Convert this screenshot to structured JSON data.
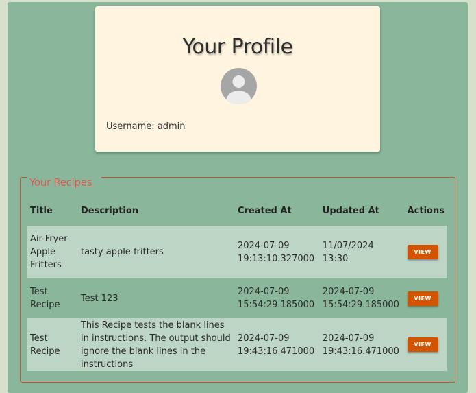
{
  "profile": {
    "title": "Your Profile",
    "username_label": "Username: admin"
  },
  "recipes": {
    "legend": "Your Recipes",
    "columns": {
      "title": "Title",
      "description": "Description",
      "created": "Created At",
      "updated": "Updated At",
      "actions": "Actions"
    },
    "rows": [
      {
        "title": "Air-Fryer Apple Fritters",
        "description": "tasty apple fritters",
        "created": "2024-07-09 19:13:10.327000",
        "updated": "11/07/2024 13:30",
        "action": "VIEW"
      },
      {
        "title": "Test Recipe",
        "description": "Test 123",
        "created": "2024-07-09 15:54:29.185000",
        "updated": "2024-07-09 15:54:29.185000",
        "action": "VIEW"
      },
      {
        "title": "Test Recipe",
        "description": "This Recipe tests the blank lines in instructions. The output should ignore the blank lines in the instructions",
        "created": "2024-07-09 19:43:16.471000",
        "updated": "2024-07-09 19:43:16.471000",
        "action": "VIEW"
      }
    ]
  },
  "colors": {
    "panel": "#8ab79b",
    "card": "#fff4df",
    "accent": "#d35400",
    "legend": "#d9584f"
  }
}
